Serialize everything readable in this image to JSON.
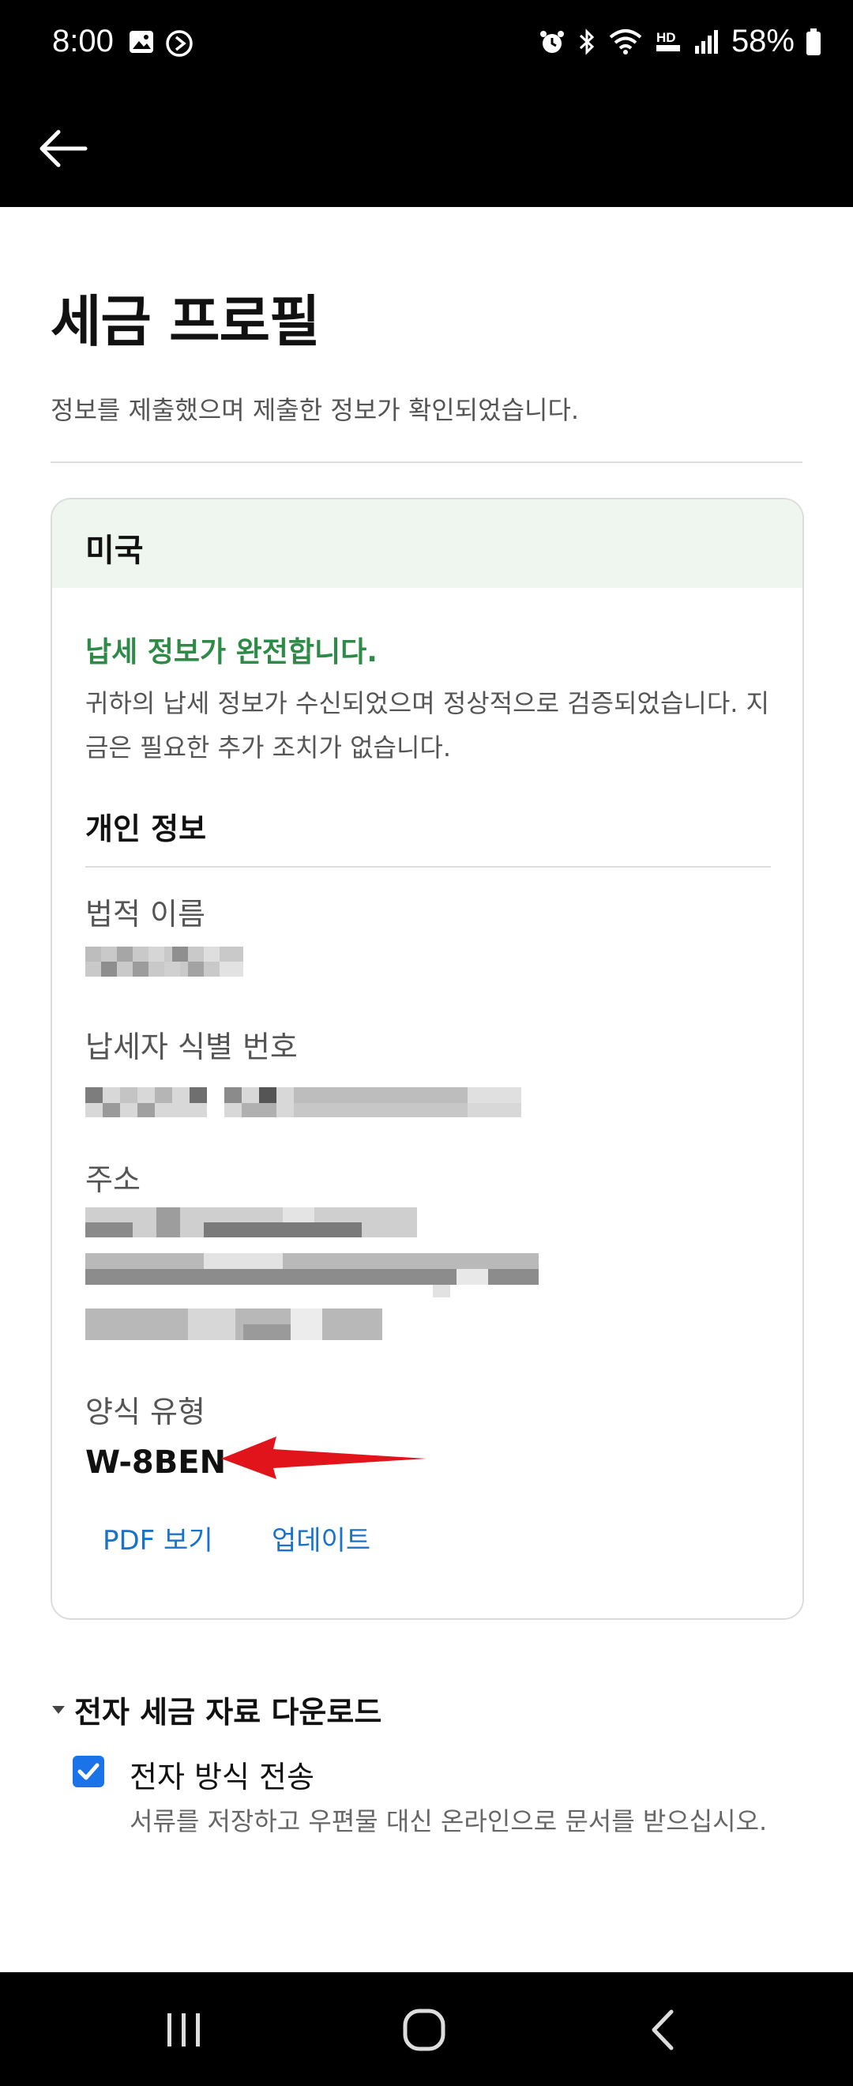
{
  "status_bar": {
    "time": "8:00",
    "battery": "58%",
    "left_icons": [
      "image-icon",
      "sync-icon"
    ],
    "right_icons": [
      "alarm-icon",
      "bluetooth-icon",
      "wifi-icon",
      "hd-voice-icon",
      "signal-icon",
      "battery-icon"
    ]
  },
  "app_bar": {
    "back_icon": "arrow-left-icon"
  },
  "header": {
    "title": "세금 프로필",
    "subtitle": "정보를 제출했으며 제출한 정보가 확인되었습니다."
  },
  "card": {
    "country": "미국",
    "status_title": "납세 정보가 완전합니다.",
    "status_desc": "귀하의 납세 정보가 수신되었으며 정상적으로 검증되었습니다. 지금은 필요한 추가 조치가 없습니다.",
    "section_title": "개인 정보",
    "fields": {
      "legal_name_label": "법적 이름",
      "tin_label": "납세자 식별 번호",
      "address_label": "주소",
      "form_type_label": "양식 유형",
      "form_type_value": "W-8BEN"
    },
    "links": {
      "view_pdf": "PDF 보기",
      "update": "업데이트"
    }
  },
  "downloads": {
    "title": "전자 세금 자료 다운로드",
    "option_label": "전자 방식 전송",
    "option_checked": true,
    "option_desc": "서류를 저장하고 우편물 대신 온라인으로 문서를 받으십시오."
  },
  "colors": {
    "accent_green": "#2e8b47",
    "link_blue": "#1a73c8",
    "checkbox_blue": "#1a73e8",
    "annotation_red": "#e0141a"
  }
}
